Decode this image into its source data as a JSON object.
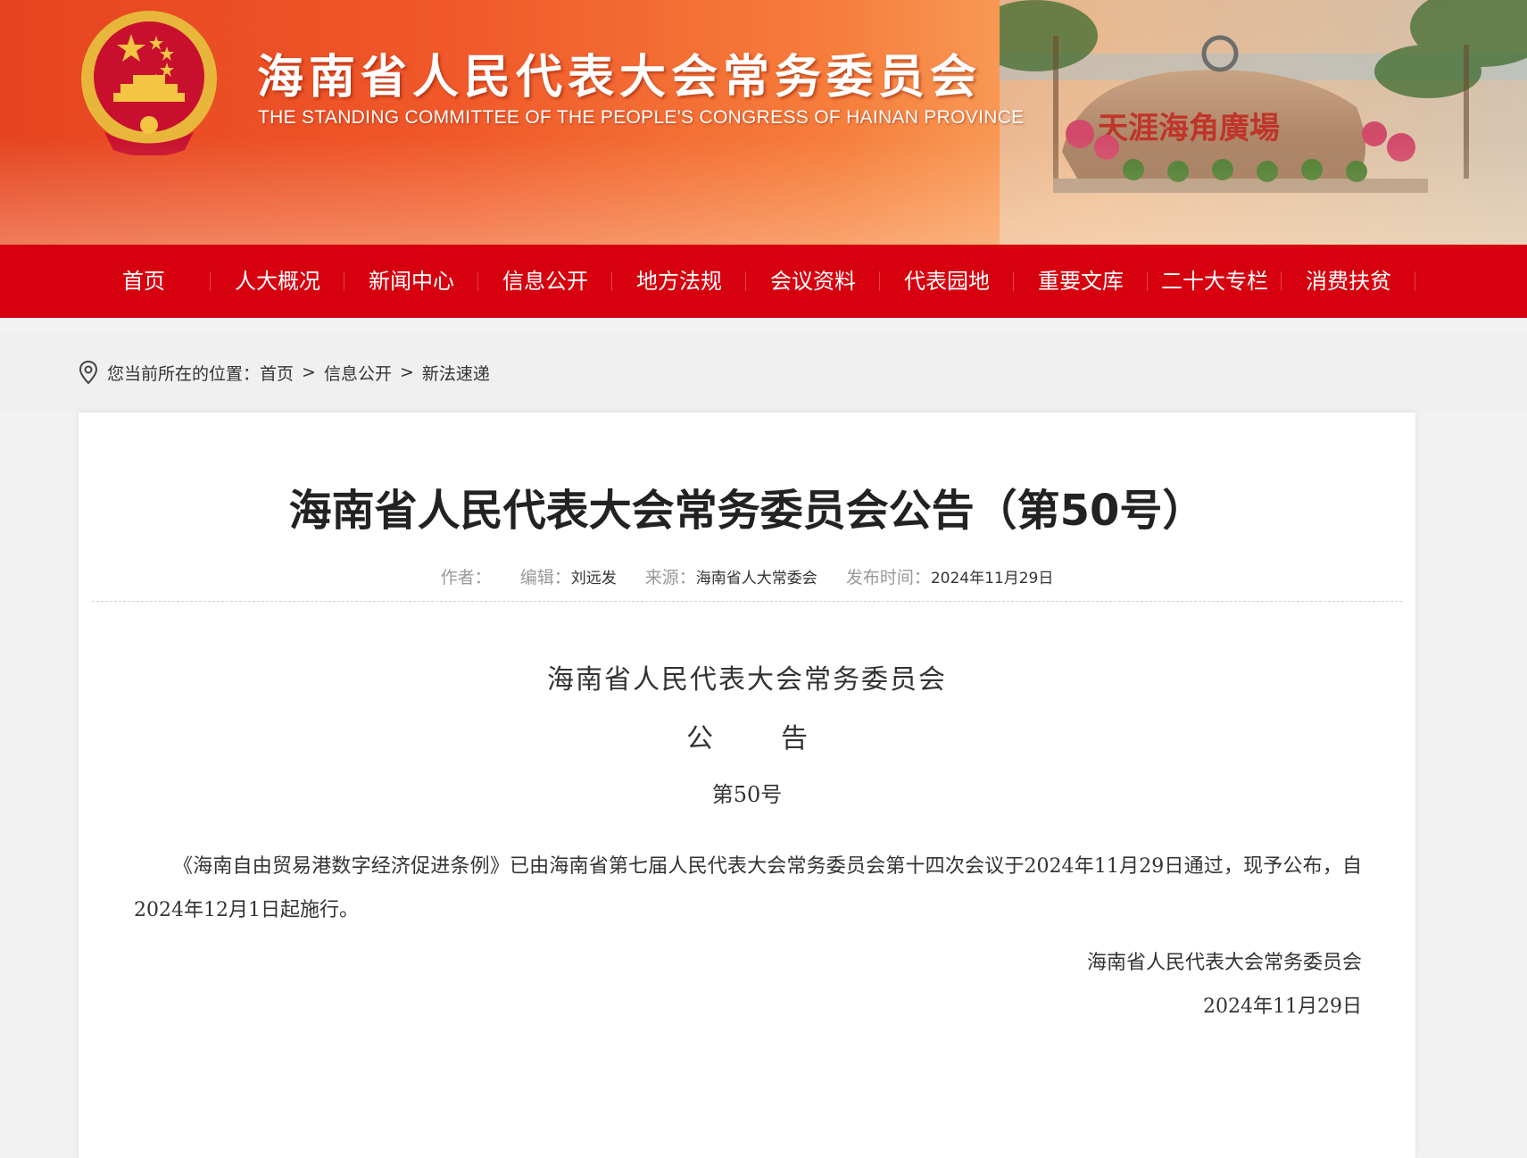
{
  "header": {
    "title": "海南省人民代表大会常务委员会",
    "subtitle": "THE STANDING COMMITTEE OF THE PEOPLE'S CONGRESS OF HAINAN PROVINCE",
    "scenery_text": "天涯海角廣場"
  },
  "nav": {
    "items": [
      "首页",
      "人大概况",
      "新闻中心",
      "信息公开",
      "地方法规",
      "会议资料",
      "代表园地",
      "重要文库",
      "二十大专栏",
      "消费扶贫"
    ]
  },
  "breadcrumb": {
    "prefix": "您当前所在的位置：",
    "items": [
      "首页",
      "信息公开",
      "新法速递"
    ],
    "separator": ">"
  },
  "article": {
    "title": "海南省人民代表大会常务委员会公告（第50号）",
    "meta": {
      "author_label": "作者：",
      "author": "",
      "editor_label": "编辑：",
      "editor": "刘远发",
      "source_label": "来源：",
      "source": "海南省人大常委会",
      "date_label": "发布时间：",
      "date": "2024年11月29日"
    },
    "doc": {
      "org": "海南省人民代表大会常务委员会",
      "type_chars": [
        "公",
        "告"
      ],
      "number": "第50号",
      "body": "《海南自由贸易港数字经济促进条例》已由海南省第七届人民代表大会常务委员会第十四次会议于2024年11月29日通过，现予公布，自2024年12月1日起施行。",
      "signature": "海南省人民代表大会常务委员会",
      "sign_date": "2024年11月29日"
    }
  },
  "colors": {
    "nav_red": "#d7000f",
    "banner_orange": "#f0592a"
  }
}
